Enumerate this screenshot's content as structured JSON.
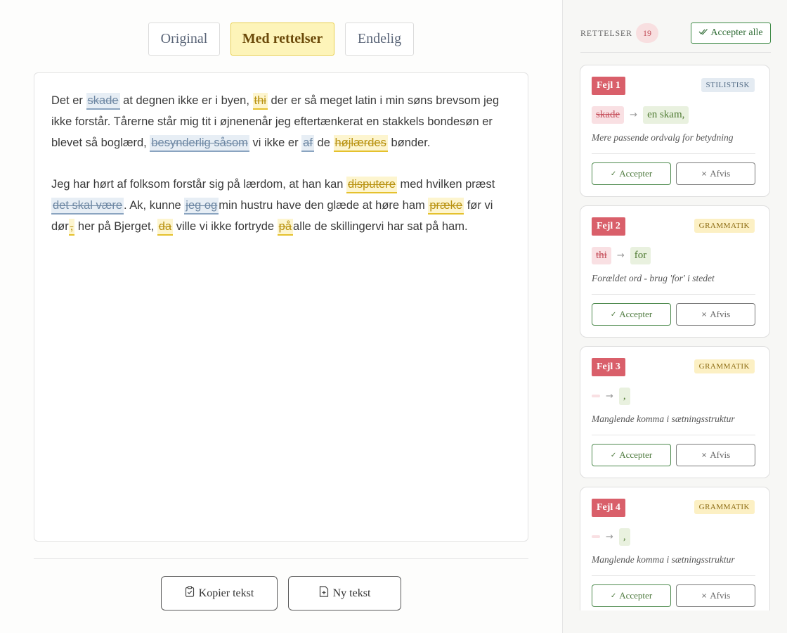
{
  "tabs": [
    {
      "label": "Original"
    },
    {
      "label": "Med rettelser"
    },
    {
      "label": "Endelig"
    }
  ],
  "paragraph1": {
    "t1": "Det er ",
    "m1": "skade",
    "t2": " at degnen ikke er i byen, ",
    "m2": "thi",
    "t3": " der er så meget latin i min søns brevsom jeg ikke forstår. Tårerne står mig tit i øjnenenår jeg eftertænkerat en stakkels bondesøn er blevet så boglærd, ",
    "m3": "besynderlig såsom",
    "t4": " vi ikke er ",
    "m4": "af",
    "t5": " de ",
    "m5": "højlærdes",
    "t6": " bønder."
  },
  "paragraph2": {
    "t1": "Jeg har hørt af folksom forstår sig på lærdom, at han kan ",
    "m1": "disputere",
    "t2": " med hvilken præst ",
    "m2": "det skal være",
    "t3": ". Ak, kunne ",
    "m3": "jeg og",
    "t4": "min hustru have den glæde at høre ham ",
    "m4": "præke",
    "t5": " før vi dør",
    "m5": ",",
    "t6": " her på Bjerget, ",
    "m6": "da",
    "t7": " ville vi ikke fortryde ",
    "m7": "på",
    "t8": "alle de skillingervi har sat på ham."
  },
  "bottom": {
    "copy_label": "Kopier tekst",
    "new_label": "Ny tekst"
  },
  "sidebar": {
    "title": "RETTELSER",
    "count": "19",
    "accept_all_label": "Accepter alle",
    "cards": [
      {
        "label": "Fejl 1",
        "category": "STILISTISK",
        "original": "skade",
        "replacement": "en skam,",
        "description": "Mere passende ordvalg for betydning",
        "accept": "Accepter",
        "reject": "Afvis"
      },
      {
        "label": "Fejl 2",
        "category": "GRAMMATIK",
        "original": "thi",
        "replacement": "for",
        "description": "Forældet ord - brug 'for' i stedet",
        "accept": "Accepter",
        "reject": "Afvis"
      },
      {
        "label": "Fejl 3",
        "category": "GRAMMATIK",
        "original": "",
        "replacement": ",",
        "description": "Manglende komma i sætningsstruktur",
        "accept": "Accepter",
        "reject": "Afvis"
      },
      {
        "label": "Fejl 4",
        "category": "GRAMMATIK",
        "original": "",
        "replacement": ",",
        "description": "Manglende komma i sætningsstruktur",
        "accept": "Accepter",
        "reject": "Afvis"
      }
    ]
  },
  "colors": {
    "accent_yellow": "#fdf4b9",
    "error_red": "#d95f6a",
    "accept_green": "#3e8a46",
    "stilistisk_blue": "#8aa4c0",
    "grammatik_yellow": "#e5c12d"
  }
}
